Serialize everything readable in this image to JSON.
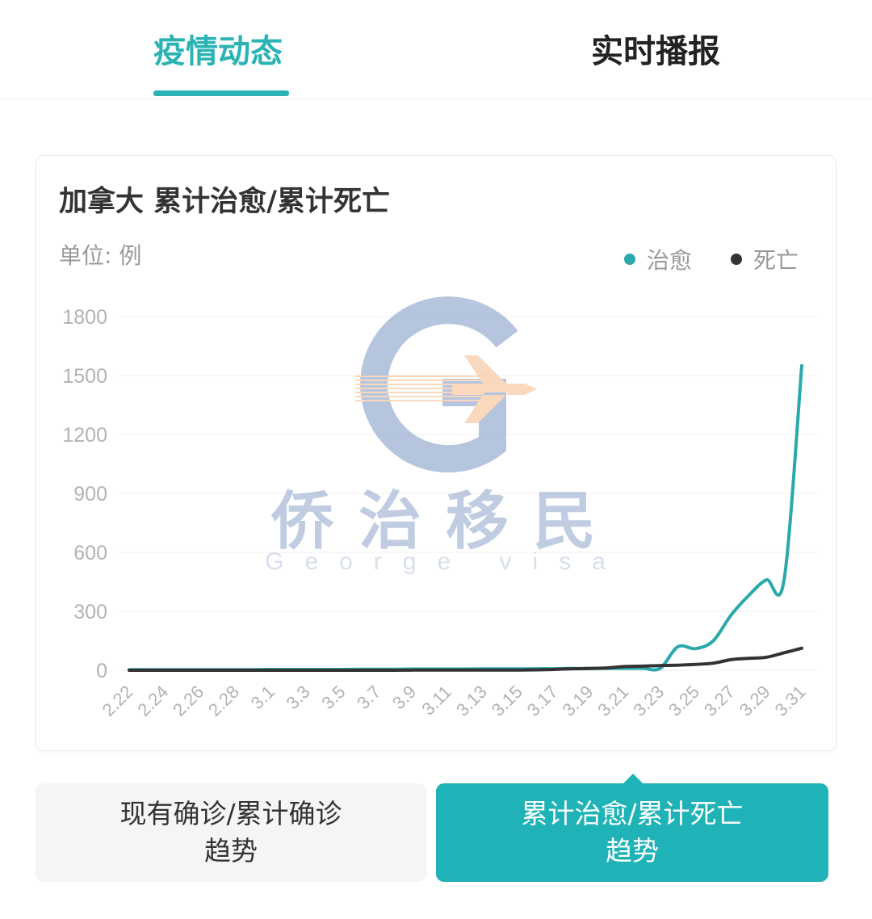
{
  "tabs": {
    "active": "疫情动态",
    "inactive": "实时播报"
  },
  "card": {
    "title": "加拿大 累计治愈/累计死亡",
    "unit": "单位: 例"
  },
  "colors": {
    "accent": "#2bb3b3",
    "cured": "#2aa9ab",
    "death": "#333333"
  },
  "buttons": {
    "left_line1": "现有确诊/累计确诊",
    "left_line2": "趋势",
    "right_line1": "累计治愈/累计死亡",
    "right_line2": "趋势"
  },
  "watermark": {
    "name": "侨治移民",
    "sub": "George visa"
  },
  "chart_data": {
    "type": "line",
    "title": "加拿大 累计治愈/累计死亡",
    "ylabel": "单位: 例",
    "ylim": [
      0,
      1800
    ],
    "yticks": [
      0,
      300,
      600,
      900,
      1200,
      1500,
      1800
    ],
    "grid": true,
    "legend_position": "top-right",
    "categories": [
      "2.22",
      "2.23",
      "2.24",
      "2.25",
      "2.26",
      "2.27",
      "2.28",
      "2.29",
      "3.1",
      "3.2",
      "3.3",
      "3.4",
      "3.5",
      "3.6",
      "3.7",
      "3.8",
      "3.9",
      "3.10",
      "3.11",
      "3.12",
      "3.13",
      "3.14",
      "3.15",
      "3.16",
      "3.17",
      "3.18",
      "3.19",
      "3.20",
      "3.21",
      "3.22",
      "3.23",
      "3.24",
      "3.25",
      "3.26",
      "3.27",
      "3.28",
      "3.29",
      "3.30",
      "3.31"
    ],
    "tick_labels": [
      "2.22",
      "2.24",
      "2.26",
      "2.28",
      "3.1",
      "3.3",
      "3.5",
      "3.7",
      "3.9",
      "3.11",
      "3.13",
      "3.15",
      "3.17",
      "3.19",
      "3.21",
      "3.23",
      "3.25",
      "3.27",
      "3.29",
      "3.31"
    ],
    "series": [
      {
        "name": "治愈",
        "values": [
          3,
          3,
          3,
          3,
          3,
          3,
          3,
          3,
          4,
          4,
          4,
          4,
          4,
          5,
          5,
          5,
          6,
          6,
          6,
          6,
          7,
          7,
          7,
          8,
          8,
          9,
          9,
          10,
          10,
          10,
          10,
          120,
          110,
          150,
          280,
          380,
          460,
          460,
          1550
        ]
      },
      {
        "name": "死亡",
        "values": [
          0,
          0,
          0,
          0,
          0,
          0,
          0,
          0,
          0,
          0,
          0,
          0,
          0,
          0,
          0,
          0,
          1,
          1,
          1,
          1,
          1,
          1,
          1,
          2,
          4,
          8,
          9,
          12,
          19,
          21,
          24,
          26,
          30,
          36,
          54,
          61,
          66,
          89,
          112
        ]
      }
    ]
  }
}
